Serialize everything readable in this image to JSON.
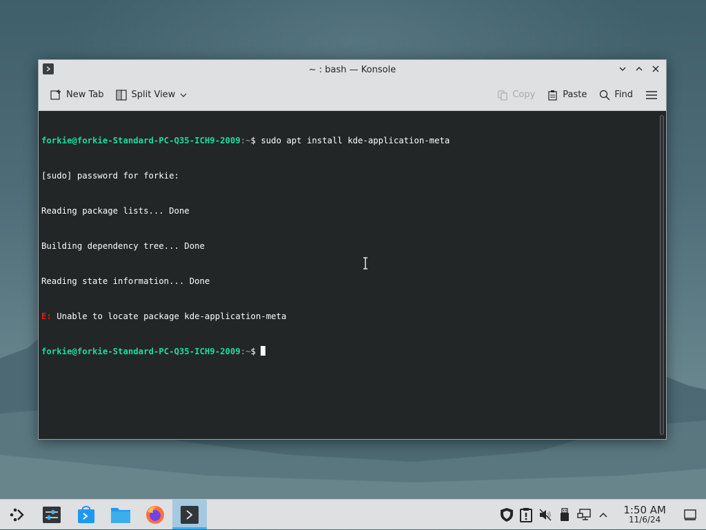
{
  "window": {
    "title": "~ : bash — Konsole"
  },
  "toolbar": {
    "new_tab": "New Tab",
    "split_view": "Split View",
    "copy": "Copy",
    "paste": "Paste",
    "find": "Find"
  },
  "terminal": {
    "lines": [
      {
        "user": "forkie@forkie-Standard-PC-Q35-ICH9-2009",
        "path": ":~",
        "cmd": "$ sudo apt install kde-application-meta"
      },
      {
        "text": "[sudo] password for forkie:"
      },
      {
        "text": "Reading package lists... Done"
      },
      {
        "text": "Building dependency tree... Done"
      },
      {
        "text": "Reading state information... Done"
      },
      {
        "err": "E:",
        "text": " Unable to locate package kde-application-meta"
      },
      {
        "user": "forkie@forkie-Standard-PC-Q35-ICH9-2009",
        "path": ":~",
        "cmd": "$ "
      }
    ]
  },
  "taskbar": {
    "apps": [
      "launcher-icon",
      "system-settings-icon",
      "discover-store-icon",
      "dolphin-files-icon",
      "firefox-icon",
      "konsole-icon"
    ],
    "tray": [
      "shield-icon",
      "clipboard-alert-icon",
      "volume-muted-icon",
      "usb-device-icon",
      "network-wired-icon",
      "chevron-up-icon"
    ],
    "time": "1:50 AM",
    "date": "11/6/24"
  },
  "colors": {
    "prompt": "#1cdc9a",
    "error": "#ed1515",
    "accent": "#3daee9",
    "terminal_bg": "#232627"
  }
}
